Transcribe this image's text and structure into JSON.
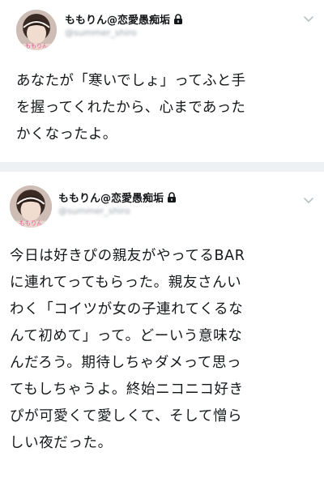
{
  "tweets": [
    {
      "display_name": "ももりん@恋愛愚痴垢",
      "handle": "@summer_shiro",
      "avatar_caption": "ももりん",
      "lines": [
        "あなたが「寒いでしょ」ってふと手",
        "を握ってくれたから、心まであった",
        "かくなったよ。"
      ]
    },
    {
      "display_name": "ももりん@恋愛愚痴垢",
      "handle": "@summer_shiro",
      "avatar_caption": "ももりん",
      "lines": [
        "今日は好きぴの親友がやってるBAR",
        "に連れてってもらった。親友さんい",
        "わく「コイツが女の子連れてくるな",
        "んて初めて」って。どーいう意味な",
        "んだろう。期待しちゃダメって思っ",
        "てもしちゃうよ。終始ニコニコ好き",
        "ぴが可愛くて愛しくて、そして憎ら",
        "しい夜だった。"
      ]
    }
  ],
  "icons": {
    "lock": "lock-icon",
    "caret": "chevron-down-icon"
  },
  "colors": {
    "text": "#14171a",
    "muted": "#9aa3ab",
    "divider": "#eef1f4",
    "avatar_caption": "#e8589a"
  }
}
